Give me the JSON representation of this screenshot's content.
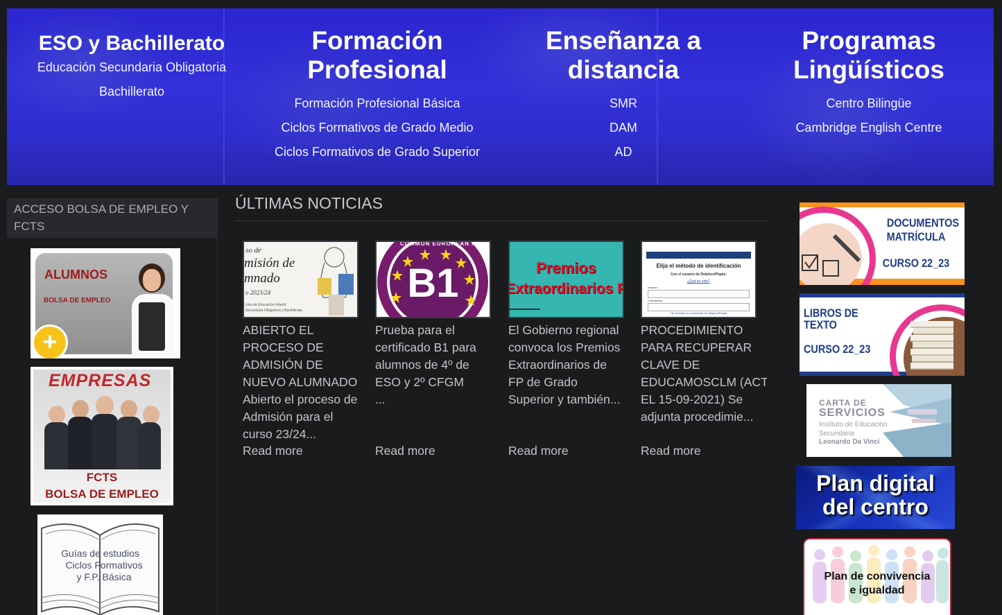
{
  "banner": {
    "columns": [
      {
        "title": "ESO y Bachillerato",
        "items": [
          "Educación Secundaria Obligatoria",
          "Bachillerato"
        ]
      },
      {
        "title": "Formación Profesional",
        "items": [
          "Formación Profesional Básica",
          "Ciclos Formativos de Grado Medio",
          "Ciclos Formativos de Grado Superior"
        ]
      },
      {
        "title": "Enseñanza a distancia",
        "items": [
          "SMR",
          "DAM",
          "AD"
        ]
      },
      {
        "title": "Programas Lingüísticos",
        "items": [
          "Centro Bilingüe",
          "Cambridge English Centre"
        ]
      }
    ]
  },
  "left_sidebar": {
    "heading": "ACCESO BOLSA DE EMPLEO Y FCTS",
    "alumnos": {
      "title": "ALUMNOS",
      "subtitle": "BOLSA DE EMPLEO",
      "plus": "+"
    },
    "empresas": {
      "title": "EMPRESAS",
      "line1": "FCTS",
      "line2": "BOLSA DE EMPLEO"
    },
    "guias": {
      "line1": "Guías de estudios",
      "line2": "Ciclos Formativos",
      "line3": "y F.P. Básica"
    }
  },
  "news": {
    "title": "ÚLTIMAS NOTICIAS",
    "read_more": "Read more",
    "items": [
      {
        "text": "ABIERTO EL\nPROCESO DE\nADMISIÓN DE\nNUEVO ALUMNADO\nAbierto el proceso de\nAdmisión para el\ncurso 23/24...",
        "thumb": {
          "l1": "so de",
          "l2": "misión de",
          "l3": "mnado",
          "l4": "o 2023/24",
          "l5": "ciclo de Educación Infantil,",
          "l6": "Secundaria Obligatoria y Bachillerato"
        }
      },
      {
        "text": "Prueba para el\ncertificado B1 para\nalumnos de 4º de\nESO y 2º CFGM\n...",
        "thumb": {
          "badge": "B1",
          "ring": "COMMON EUROPEAN FRAMEWORK OF REFERENCE"
        }
      },
      {
        "text": "El Gobierno regional\nconvoca los Premios\nExtraordinarios de\nFP de Grado\nSuperior y también...",
        "thumb": {
          "l1": "Premios",
          "l2": "Extraordinarios F."
        }
      },
      {
        "text": "PROCEDIMIENTO\nPARA RECUPERAR\nCLAVE DE\nEDUCAMOSCLM (ACT\nEL 15-09-2021) Se\nadjunta procedimie...",
        "thumb": {
          "l1": "Elija el método de identificación",
          "l2": "Con el usuario de Delphos/Papás:",
          "l3": "¿Qué es esto?",
          "l4": "Usuario:",
          "l5": "Contraseña:",
          "l6": "He olvidado mi contraseña de Delphos/Papás"
        }
      }
    ]
  },
  "right_sidebar": {
    "documentos": {
      "l1": "DOCUMENTOS",
      "l2": "MATRÍCULA",
      "l3": "CURSO 22_23"
    },
    "libros": {
      "l1": "LIBROS DE",
      "l2": "TEXTO",
      "l3": "CURSO 22_23"
    },
    "carta": {
      "l1": "CARTA DE",
      "l2": "SERVICIOS",
      "l3": "Instituto de Educación",
      "l4": "Secundaria",
      "l5": "Leonardo Da Vinci"
    },
    "plan_digital": {
      "l1": "Plan digital",
      "l2": "del centro"
    },
    "plan_convivencia": {
      "l1": "Plan de convivencia",
      "l2": "e igualdad"
    }
  },
  "colors": {
    "background": "#1a1b1d",
    "banner": "#2f2dd2",
    "text": "#c2c4c8",
    "accent_orange": "#f7931e",
    "accent_pink": "#e8378f"
  }
}
